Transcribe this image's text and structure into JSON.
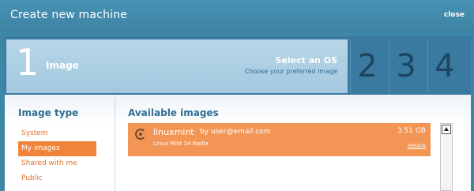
{
  "window": {
    "title": "Create new machine",
    "close_label": "close"
  },
  "wizard": {
    "active_step": {
      "number": "1",
      "name": "Image",
      "heading": "Select an OS",
      "subheading": "Choose your preferred image"
    },
    "steps": [
      "2",
      "3",
      "4"
    ]
  },
  "sidebar": {
    "label": "Image type",
    "items": [
      {
        "label": "System",
        "active": false
      },
      {
        "label": "My images",
        "active": true
      },
      {
        "label": "Shared with me",
        "active": false
      },
      {
        "label": "Public",
        "active": false
      }
    ]
  },
  "main": {
    "label": "Available images",
    "images": [
      {
        "icon": "linux-mint-icon",
        "name": "linuxmint",
        "owner": "by user@email.com",
        "description": "Linux Mint 14 Nadia",
        "size": "3.51 GB",
        "details_label": "details"
      }
    ]
  },
  "colors": {
    "accent": "#ef843a",
    "brand": "#3e86a8",
    "heading": "#2f6d93"
  }
}
